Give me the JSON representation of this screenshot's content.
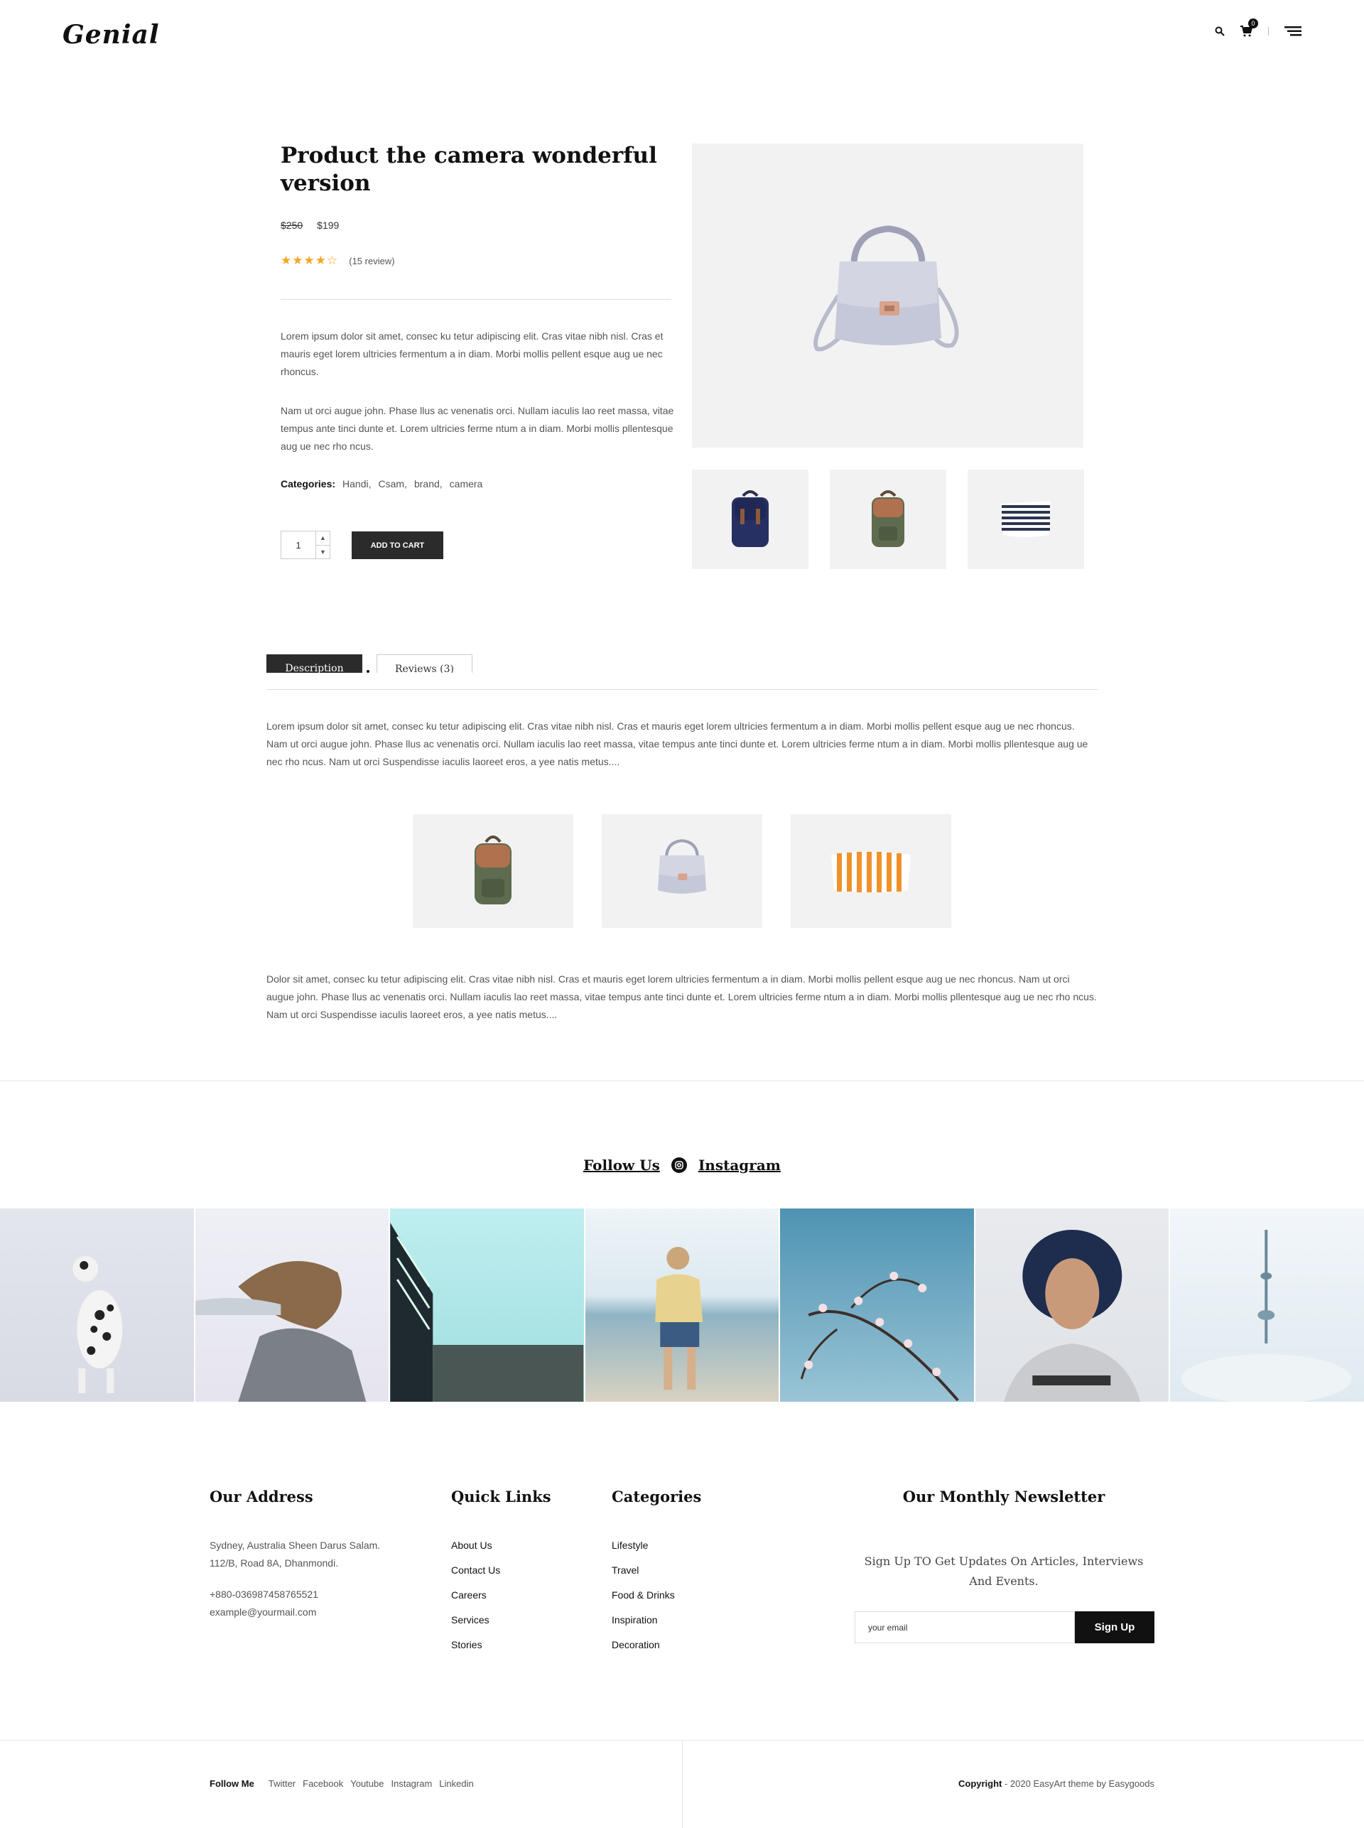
{
  "header": {
    "logo": "Genial",
    "cart_count": "0"
  },
  "product": {
    "title": "Product the camera wonderful version",
    "old_price": "$250",
    "price": "$199",
    "rating_stars": 4,
    "review_text": "(15 review)",
    "paragraph1": "Lorem ipsum dolor sit amet, consec ku tetur adipiscing elit. Cras vitae nibh nisl. Cras et mauris eget lorem ultricies fermentum a in diam. Morbi mollis pellent esque aug ue nec rhoncus.",
    "paragraph2": "Nam ut orci augue john. Phase llus ac venenatis orci. Nullam iaculis lao reet massa, vitae tempus ante tinci dunte et. Lorem ultricies ferme ntum a in diam. Morbi mollis pllentesque aug ue nec rho ncus.",
    "categories_label": "Categories:",
    "categories": [
      "Handi,",
      "Csam,",
      "brand,",
      "camera"
    ],
    "quantity": "1",
    "add_to_cart": "ADD TO CART"
  },
  "tabs": {
    "description": "Description",
    "reviews": "Reviews (3)"
  },
  "description": {
    "paragraph1": "Lorem ipsum dolor sit amet, consec ku tetur adipiscing elit. Cras vitae nibh nisl. Cras et mauris eget lorem ultricies fermentum a in diam. Morbi mollis pellent esque aug ue nec rhoncus. Nam ut orci augue john. Phase llus ac venenatis orci. Nullam iaculis lao reet massa, vitae tempus ante tinci dunte et. Lorem ultricies ferme ntum a in diam. Morbi mollis pllentesque aug ue nec rho ncus. Nam ut orci Suspendisse iaculis laoreet eros, a yee natis metus....",
    "paragraph2": "Dolor sit amet, consec ku tetur adipiscing elit. Cras vitae nibh nisl. Cras et mauris eget lorem ultricies fermentum a in diam. Morbi mollis pellent esque aug ue nec rhoncus. Nam ut orci augue john. Phase llus ac venenatis orci. Nullam iaculis lao reet massa, vitae tempus ante tinci dunte et. Lorem ultricies ferme ntum a in diam. Morbi mollis pllentesque aug ue nec rho ncus. Nam ut orci Suspendisse iaculis laoreet eros, a yee natis metus...."
  },
  "follow": {
    "follow_us": "Follow Us",
    "instagram": "Instagram"
  },
  "footer": {
    "address_title": "Our Address",
    "address_line1": "Sydney, Australia Sheen Darus Salam.",
    "address_line2": "112/B, Road 8A, Dhanmondi.",
    "phone": "+880-036987458765521",
    "email": "example@yourmail.com",
    "quick_title": "Quick Links",
    "quick_links": [
      "About Us",
      "Contact Us",
      "Careers",
      "Services",
      "Stories"
    ],
    "categories_title": "Categories",
    "categories": [
      "Lifestyle",
      "Travel",
      "Food & Drinks",
      "Inspiration",
      "Decoration"
    ],
    "newsletter_title": "Our Monthly Newsletter",
    "newsletter_subtitle": "Sign Up TO Get Updates On Articles, Interviews And Events.",
    "email_placeholder": "your email",
    "signup": "Sign Up"
  },
  "bottom": {
    "follow_me": "Follow Me",
    "links": [
      "Twitter",
      "Facebook",
      "Youtube",
      "Instagram",
      "Linkedin"
    ],
    "copyright_label": "Copyright",
    "copyright_text": " - 2020 EasyArt theme by Easygoods"
  },
  "colors": {
    "star": "#f5a623",
    "dark_button": "#2b2b2b",
    "image_bg": "#f2f2f2"
  }
}
